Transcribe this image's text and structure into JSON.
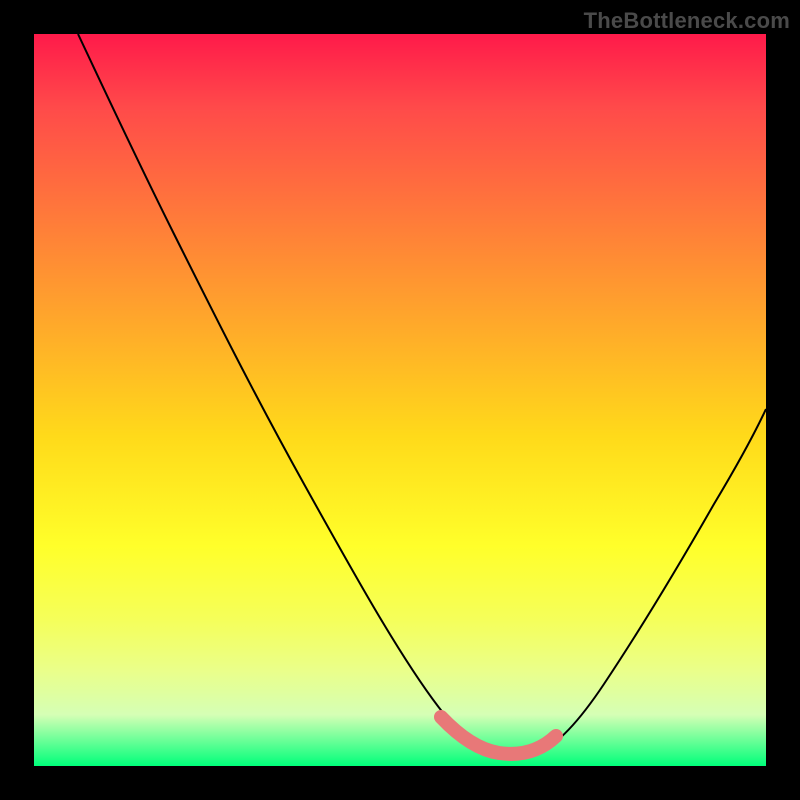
{
  "watermark": "TheBottleneck.com",
  "colors": {
    "page_bg": "#000000",
    "gradient_top": "#ff1a4a",
    "gradient_bottom": "#00ff7a",
    "curve": "#000000",
    "marker": "#e87878",
    "watermark_text": "#4a4a4a"
  },
  "chart_data": {
    "type": "line",
    "title": "",
    "xlabel": "",
    "ylabel": "",
    "xlim": [
      0,
      100
    ],
    "ylim": [
      0,
      100
    ],
    "grid": false,
    "legend": false,
    "series": [
      {
        "name": "bottleneck-curve",
        "x": [
          6,
          10,
          15,
          20,
          25,
          30,
          35,
          40,
          45,
          50,
          55,
          58,
          60,
          62,
          64,
          66,
          68,
          70,
          72,
          75,
          80,
          85,
          90,
          95,
          100
        ],
        "y": [
          100,
          92,
          83,
          74,
          65,
          56,
          47,
          38,
          30,
          22,
          14,
          9,
          6,
          4,
          2.5,
          2,
          2,
          2.5,
          3.5,
          6,
          13,
          22,
          32,
          43,
          55
        ]
      },
      {
        "name": "optimal-marker",
        "x": [
          57,
          60,
          63,
          66,
          69,
          72
        ],
        "y": [
          6,
          3,
          2,
          2,
          2.5,
          4
        ]
      }
    ],
    "annotations": []
  }
}
